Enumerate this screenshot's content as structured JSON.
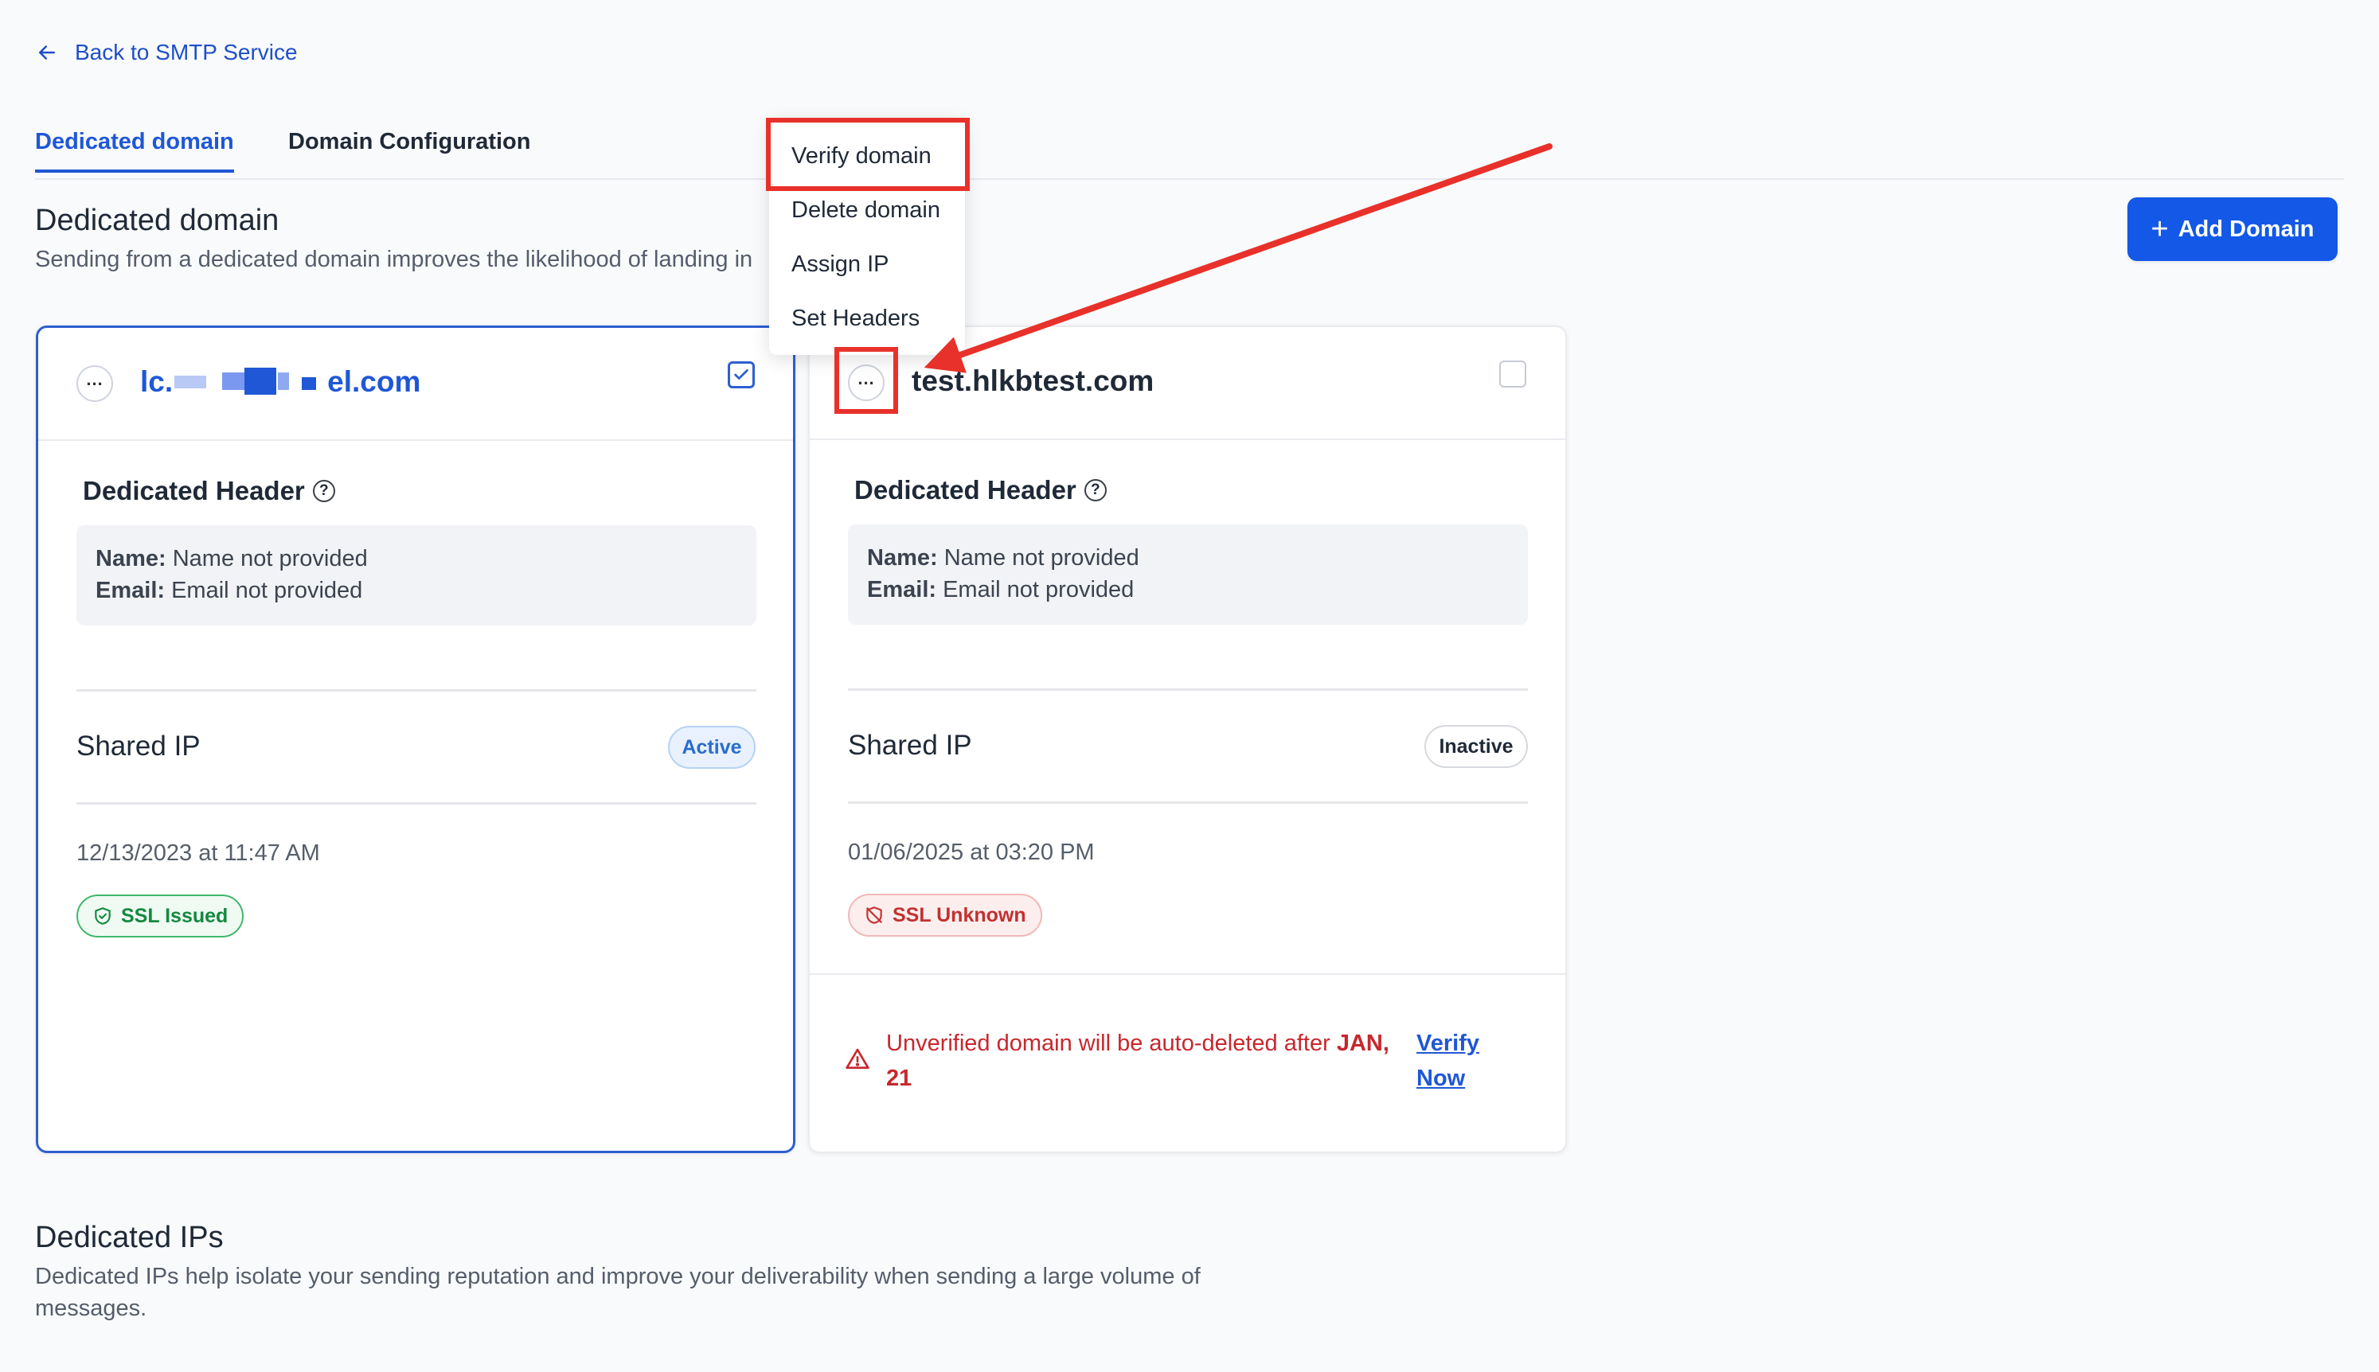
{
  "nav": {
    "back_label": "Back to SMTP Service"
  },
  "tabs": [
    {
      "label": "Dedicated domain",
      "active": true
    },
    {
      "label": "Domain Configuration",
      "active": false
    }
  ],
  "dedicated_domain": {
    "title": "Dedicated domain",
    "description": "Sending from a dedicated domain improves the likelihood of landing in",
    "add_button_label": "Add Domain"
  },
  "menu": {
    "items": [
      "Verify domain",
      "Delete domain",
      "Assign IP",
      "Set Headers"
    ]
  },
  "cards": [
    {
      "domain_visible_start": "lc.",
      "domain_visible_end": "el.com",
      "selected": true,
      "header_title": "Dedicated Header",
      "name_label": "Name:",
      "name_value": "Name not provided",
      "email_label": "Email:",
      "email_value": "Email not provided",
      "ip_label": "Shared IP",
      "ip_status": "Active",
      "date": "12/13/2023 at 11:47 AM",
      "ssl_status": "SSL Issued"
    },
    {
      "domain": "test.hlkbtest.com",
      "selected": false,
      "header_title": "Dedicated Header",
      "name_label": "Name:",
      "name_value": "Name not provided",
      "email_label": "Email:",
      "email_value": "Email not provided",
      "ip_label": "Shared IP",
      "ip_status": "Inactive",
      "date": "01/06/2025 at 03:20 PM",
      "ssl_status": "SSL Unknown",
      "warning_text": "Unverified domain will be auto-deleted after",
      "warning_date": "JAN, 21",
      "verify_link": "Verify Now"
    }
  ],
  "dedicated_ips": {
    "title": "Dedicated IPs",
    "description": "Dedicated IPs help isolate your sending reputation and improve your deliverability when sending a large volume of messages."
  },
  "colors": {
    "accent": "#1358e6",
    "annotation_red": "#e8312a",
    "success": "#15893f",
    "danger": "#c7272d"
  }
}
